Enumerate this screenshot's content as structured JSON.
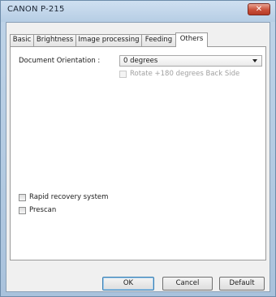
{
  "window": {
    "title": "CANON  P-215",
    "close_symbol": "✕"
  },
  "tabs": [
    {
      "label": "Basic",
      "active": false
    },
    {
      "label": "Brightness",
      "active": false
    },
    {
      "label": "Image processing",
      "active": false
    },
    {
      "label": "Feeding",
      "active": false
    },
    {
      "label": "Others",
      "active": true
    }
  ],
  "others": {
    "orientation_label": "Document Orientation :",
    "orientation_value": "0 degrees",
    "rotate_back_label": "Rotate +180 degrees Back Side",
    "rotate_back_checked": false,
    "rotate_back_enabled": false,
    "rapid_recovery_label": "Rapid recovery system",
    "rapid_recovery_checked": false,
    "prescan_label": "Prescan",
    "prescan_checked": false
  },
  "buttons": {
    "ok": "OK",
    "cancel": "Cancel",
    "default": "Default"
  }
}
